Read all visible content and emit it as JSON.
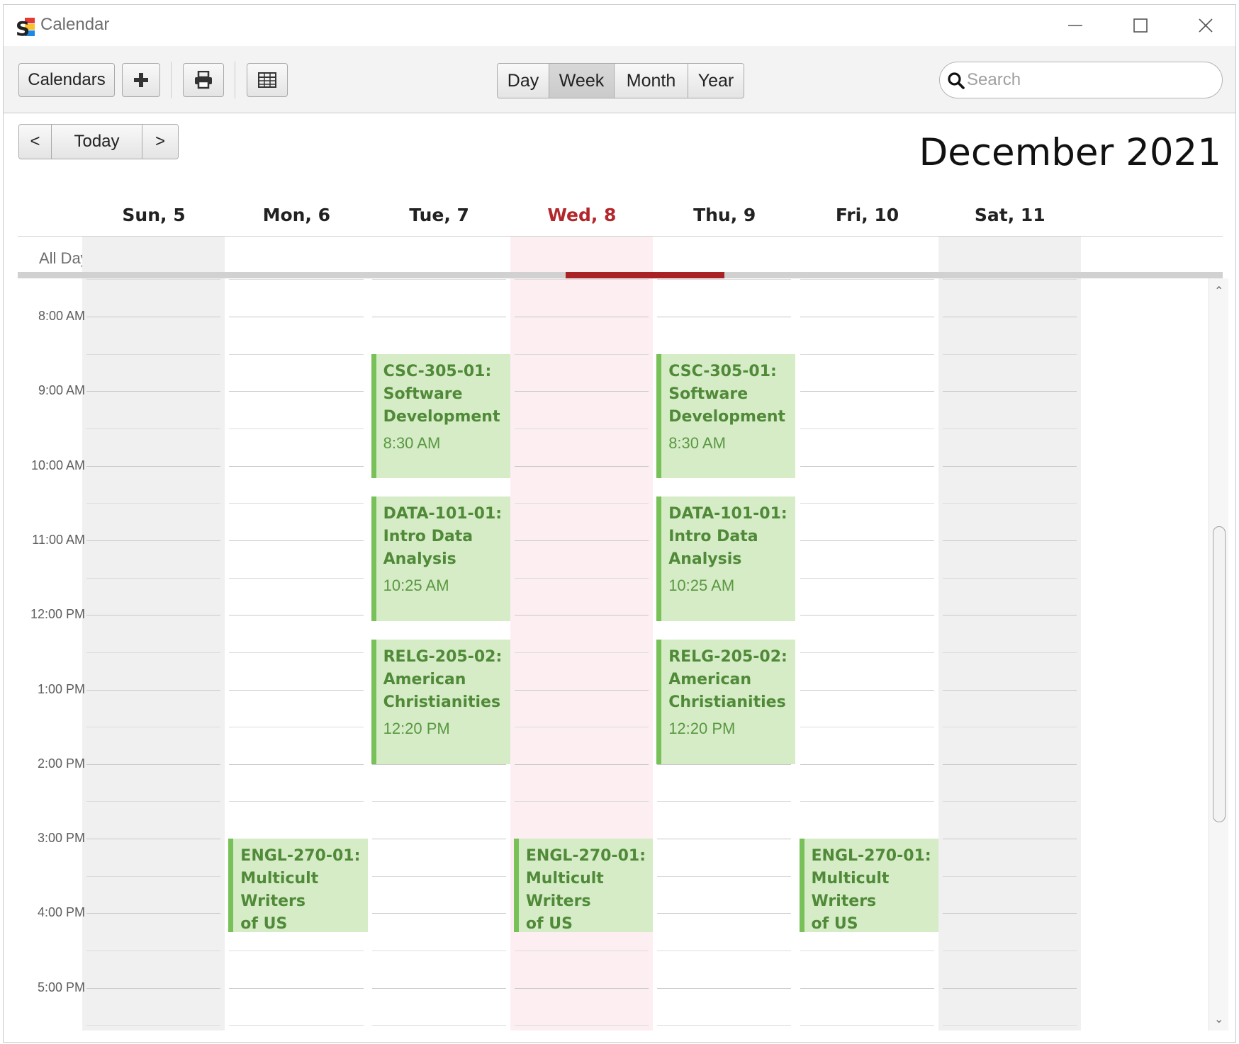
{
  "window": {
    "title": "Calendar"
  },
  "toolbar": {
    "calendars_label": "Calendars",
    "add_label": "+",
    "views": [
      "Day",
      "Week",
      "Month",
      "Year"
    ],
    "active_view": "Week",
    "search_placeholder": "Search"
  },
  "nav": {
    "prev_label": "<",
    "today_label": "Today",
    "next_label": ">"
  },
  "month_title": "December 2021",
  "days": [
    {
      "label": "Sun, 5"
    },
    {
      "label": "Mon, 6"
    },
    {
      "label": "Tue, 7"
    },
    {
      "label": "Wed, 8"
    },
    {
      "label": "Thu, 9"
    },
    {
      "label": "Fri, 10"
    },
    {
      "label": "Sat, 11"
    }
  ],
  "today_label": "Wed, 8",
  "all_day_label": "All Day",
  "times": [
    "8:00 AM",
    "9:00 AM",
    "10:00 AM",
    "11:00 AM",
    "12:00 PM",
    "1:00 PM",
    "2:00 PM",
    "3:00 PM",
    "4:00 PM",
    "5:00 PM"
  ],
  "events": [
    {
      "day": "Tue, 7",
      "title_lines": [
        "CSC-305-01:",
        "Software",
        "Development"
      ],
      "time": "8:30 AM",
      "start": "8:30 AM",
      "end": "10:10 AM"
    },
    {
      "day": "Thu, 9",
      "title_lines": [
        "CSC-305-01:",
        "Software",
        "Development"
      ],
      "time": "8:30 AM",
      "start": "8:30 AM",
      "end": "10:10 AM"
    },
    {
      "day": "Tue, 7",
      "title_lines": [
        "DATA-101-01:",
        "Intro Data Analysis"
      ],
      "time": "10:25 AM",
      "start": "10:25 AM",
      "end": "12:05 PM"
    },
    {
      "day": "Thu, 9",
      "title_lines": [
        "DATA-101-01:",
        "Intro Data Analysis"
      ],
      "time": "10:25 AM",
      "start": "10:25 AM",
      "end": "12:05 PM"
    },
    {
      "day": "Tue, 7",
      "title_lines": [
        "RELG-205-02:",
        "American",
        "Christianities"
      ],
      "time": "12:20 PM",
      "start": "12:20 PM",
      "end": "2:00 PM"
    },
    {
      "day": "Thu, 9",
      "title_lines": [
        "RELG-205-02:",
        "American",
        "Christianities"
      ],
      "time": "12:20 PM",
      "start": "12:20 PM",
      "end": "2:00 PM"
    },
    {
      "day": "Mon, 6",
      "title_lines": [
        "ENGL-270-01:",
        "Multicult Writers",
        "of US"
      ],
      "time": "",
      "start": "3:00 PM",
      "end": "4:15 PM"
    },
    {
      "day": "Wed, 8",
      "title_lines": [
        "ENGL-270-01:",
        "Multicult Writers",
        "of US"
      ],
      "time": "",
      "start": "3:00 PM",
      "end": "4:15 PM"
    },
    {
      "day": "Fri, 10",
      "title_lines": [
        "ENGL-270-01:",
        "Multicult Writers",
        "of US"
      ],
      "time": "",
      "start": "3:00 PM",
      "end": "4:15 PM"
    }
  ],
  "colors": {
    "event_bg": "#d5ecc7",
    "event_border": "#78c158",
    "event_text": "#508a38",
    "today_accent": "#b3262b",
    "today_column": "#fdeef2",
    "weekend_column": "#f0f0f0"
  },
  "icons": {
    "add": "plus-icon",
    "print": "printer-icon",
    "grid": "table-grid-icon",
    "search": "search-icon",
    "logo": "app-logo-icon"
  }
}
